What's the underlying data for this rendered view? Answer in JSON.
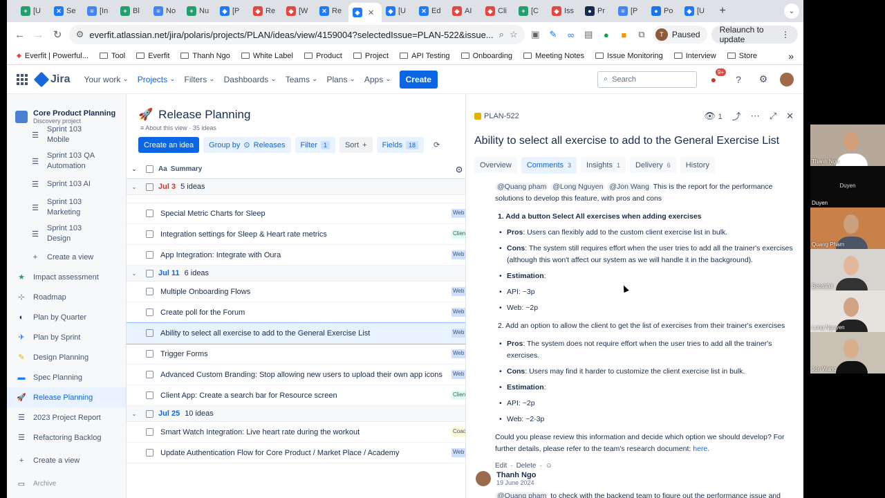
{
  "browser": {
    "tabs": [
      {
        "label": "[U",
        "color": "#22a06b",
        "glyph": "+"
      },
      {
        "label": "Se",
        "color": "#1d7afc",
        "glyph": "✕"
      },
      {
        "label": "[In",
        "color": "#4285f4",
        "glyph": "≡"
      },
      {
        "label": "Bl",
        "color": "#22a06b",
        "glyph": "+"
      },
      {
        "label": "No",
        "color": "#4285f4",
        "glyph": "≡"
      },
      {
        "label": "Nu",
        "color": "#22a06b",
        "glyph": "+"
      },
      {
        "label": "[P",
        "color": "#1d7afc",
        "glyph": "◆"
      },
      {
        "label": "Re",
        "color": "#e2483d",
        "glyph": "◆"
      },
      {
        "label": "[W",
        "color": "#e2483d",
        "glyph": "◆"
      },
      {
        "label": "Re",
        "color": "#1d7afc",
        "glyph": "✕"
      },
      {
        "label": "",
        "color": "#1d7afc",
        "glyph": "◆",
        "active": true
      },
      {
        "label": "[U",
        "color": "#1d7afc",
        "glyph": "◆"
      },
      {
        "label": "Ed",
        "color": "#1d7afc",
        "glyph": "✕"
      },
      {
        "label": "AI",
        "color": "#e2483d",
        "glyph": "◆"
      },
      {
        "label": "Cli",
        "color": "#e2483d",
        "glyph": "◆"
      },
      {
        "label": "[C",
        "color": "#22a06b",
        "glyph": "+"
      },
      {
        "label": "Iss",
        "color": "#e2483d",
        "glyph": "◆"
      },
      {
        "label": "Pr",
        "color": "#172b4d",
        "glyph": "●"
      },
      {
        "label": "[P",
        "color": "#4285f4",
        "glyph": "≡"
      },
      {
        "label": "Po",
        "color": "#1a73e8",
        "glyph": "●"
      },
      {
        "label": "[U",
        "color": "#1d7afc",
        "glyph": "◆"
      }
    ],
    "url": "everfit.atlassian.net/jira/polaris/projects/PLAN/ideas/view/4159004?selectedIssue=PLAN-522&issue...",
    "paused": "Paused",
    "relaunch": "Relaunch to update",
    "bookmarks": [
      "Everfit | Powerful...",
      "Tool",
      "Everfit",
      "Thanh Ngo",
      "White Label",
      "Product",
      "Project",
      "API Testing",
      "Onboarding",
      "Meeting Notes",
      "Issue Monitoring",
      "Interview",
      "Store"
    ]
  },
  "jira": {
    "logo": "Jira",
    "nav": [
      "Your work",
      "Projects",
      "Filters",
      "Dashboards",
      "Teams",
      "Plans",
      "Apps"
    ],
    "create": "Create",
    "search_placeholder": "Search",
    "notif_count": "9+"
  },
  "sidebar": {
    "project_name": "Core Product Planning",
    "project_type": "Discovery project",
    "sprints": [
      "Sprint 103 Mobile",
      "Sprint 103 QA Automation",
      "Sprint 103 AI",
      "Sprint 103 Marketing",
      "Sprint 103 Design"
    ],
    "create_view": "Create a view",
    "views": [
      {
        "label": "Impact assessment",
        "icon": "★",
        "color": "#22a06b"
      },
      {
        "label": "Roadmap",
        "icon": "⊹",
        "color": "#44546f"
      },
      {
        "label": "Plan by Quarter",
        "icon": "◐",
        "color": "#172b4d"
      },
      {
        "label": "Plan by Sprint",
        "icon": "✈",
        "color": "#1d7afc"
      },
      {
        "label": "Design Planning",
        "icon": "✎",
        "color": "#e2b203"
      },
      {
        "label": "Spec Planning",
        "icon": "▬",
        "color": "#1d7afc"
      },
      {
        "label": "Release Planning",
        "icon": "🚀",
        "color": "#0c66e4",
        "active": true
      },
      {
        "label": "2023 Project Report",
        "icon": "☰",
        "color": "#44546f"
      },
      {
        "label": "Refactoring Backlog",
        "icon": "☰",
        "color": "#44546f"
      }
    ],
    "create_view_bottom": "Create a view",
    "archive": "Archive"
  },
  "main": {
    "title": "Release Planning",
    "meta": "About this view · 35 ideas",
    "create_idea": "Create an idea",
    "group_by": "Group by",
    "group_value": "Releases",
    "filter": "Filter",
    "filter_count": "1",
    "sort": "Sort",
    "fields": "Fields",
    "fields_count": "18",
    "summary_header": "Summary",
    "groups": [
      {
        "date": "Jul 3",
        "count": "5 ideas",
        "color": "red",
        "rows": [
          {
            "name": "Special Metric Charts for Sleep",
            "tag": "Web",
            "tagcolor": "#cce0ff"
          },
          {
            "name": "Integration settings for Sleep & Heart rate metrics",
            "tag": "Client",
            "tagcolor": "#dcfff1"
          },
          {
            "name": "App Integration: Integrate with Oura",
            "tag": "Web",
            "tagcolor": "#cce0ff"
          }
        ]
      },
      {
        "date": "Jul 11",
        "count": "6 ideas",
        "color": "blue",
        "rows": [
          {
            "name": "Multiple Onboarding Flows",
            "tag": "Web",
            "tagcolor": "#cce0ff"
          },
          {
            "name": "Create poll for the Forum",
            "tag": "Web",
            "tagcolor": "#cce0ff"
          },
          {
            "name": "Ability to select all exercise to add to the General Exercise List",
            "tag": "Web",
            "tagcolor": "#cce0ff",
            "selected": true
          },
          {
            "name": "Trigger Forms",
            "tag": "Web",
            "tagcolor": "#cce0ff"
          },
          {
            "name": "Advanced Custom Branding: Stop allowing new users to upload their own app icons",
            "tag": "Web",
            "tagcolor": "#cce0ff"
          },
          {
            "name": "Client App: Create a search bar for Resource screen",
            "tag": "Client",
            "tagcolor": "#dcfff1"
          }
        ]
      },
      {
        "date": "Jul 25",
        "count": "10 ideas",
        "color": "blue",
        "rows": [
          {
            "name": "Smart Watch Integration: Live heart rate during the workout",
            "tag": "Coach",
            "tagcolor": "#fff7d6"
          },
          {
            "name": "Update Authentication Flow for Core Product / Market Place / Academy",
            "tag": "Web",
            "tagcolor": "#cce0ff"
          }
        ]
      }
    ]
  },
  "panel": {
    "key": "PLAN-522",
    "watchers": "1",
    "title": "Ability to select all exercise to add to the General Exercise List",
    "tabs": [
      {
        "label": "Overview",
        "n": ""
      },
      {
        "label": "Comments",
        "n": "3",
        "active": true
      },
      {
        "label": "Insights",
        "n": "1"
      },
      {
        "label": "Delivery",
        "n": "6"
      },
      {
        "label": "History",
        "n": ""
      }
    ],
    "comment": {
      "mentions": [
        "@Quang pham",
        "@Long Nguyen",
        "@Jon Wang"
      ],
      "intro": "This is the report for the performance solutions to develop this feature, with pros and cons",
      "opt1_title": "1.  Add a button Select All exercises when adding exercises",
      "opt1_pros_label": "Pros",
      "opt1_pros": ": Users can flexibly add to the custom client exercise list in bulk.",
      "opt1_cons_label": "Cons",
      "opt1_cons": ": The system still requires effort when the user tries to add all the trainer's exercises (although this won't affect our system as we will handle it in the background).",
      "estimation": "Estimation",
      "opt1_api": "API: ~3p",
      "opt1_web": "Web: ~2p",
      "opt2_title": "2.  Add an option to allow the client to get the list of exercises from their trainer's exercises",
      "opt2_pros": ": The system does not require effort when the user tries to add all the trainer's exercises.",
      "opt2_cons": ": Users may find it harder to customize the client exercise list in bulk.",
      "opt2_api": "API: ~2p",
      "opt2_web": "Web: ~2-3p",
      "closing": "Could you please review this information and decide which option we should develop? For further details, please refer to the team's research document: ",
      "link": "here.",
      "edit": "Edit",
      "delete": "Delete"
    },
    "next_author": "Thanh Ngo",
    "next_date": "19 June 2024",
    "next_mention": "@Quang pham",
    "next_text": " to check with the backend team to figure out the performance issue and"
  },
  "video": [
    {
      "name": "Thanh Ngo",
      "bg": "#b7a99a",
      "face": "#d19f7a",
      "shirt": "#fff"
    },
    {
      "name": "Duyen",
      "bg": "#0b0b0b",
      "label": "Duyen"
    },
    {
      "name": "Quang Pham",
      "bg": "#c9814a",
      "face": "#caa07f",
      "shirt": "#4a5568"
    },
    {
      "name": "Beostiful",
      "bg": "#d7d3cf",
      "face": "#e3b89a",
      "shirt": "#333"
    },
    {
      "name": "Long Nguyen",
      "bg": "#e6e3df",
      "face": "#cfa383",
      "shirt": "#222"
    },
    {
      "name": "Jon Wang",
      "bg": "#c8c1b4",
      "face": "#d8ae8c",
      "shirt": "#111"
    }
  ]
}
